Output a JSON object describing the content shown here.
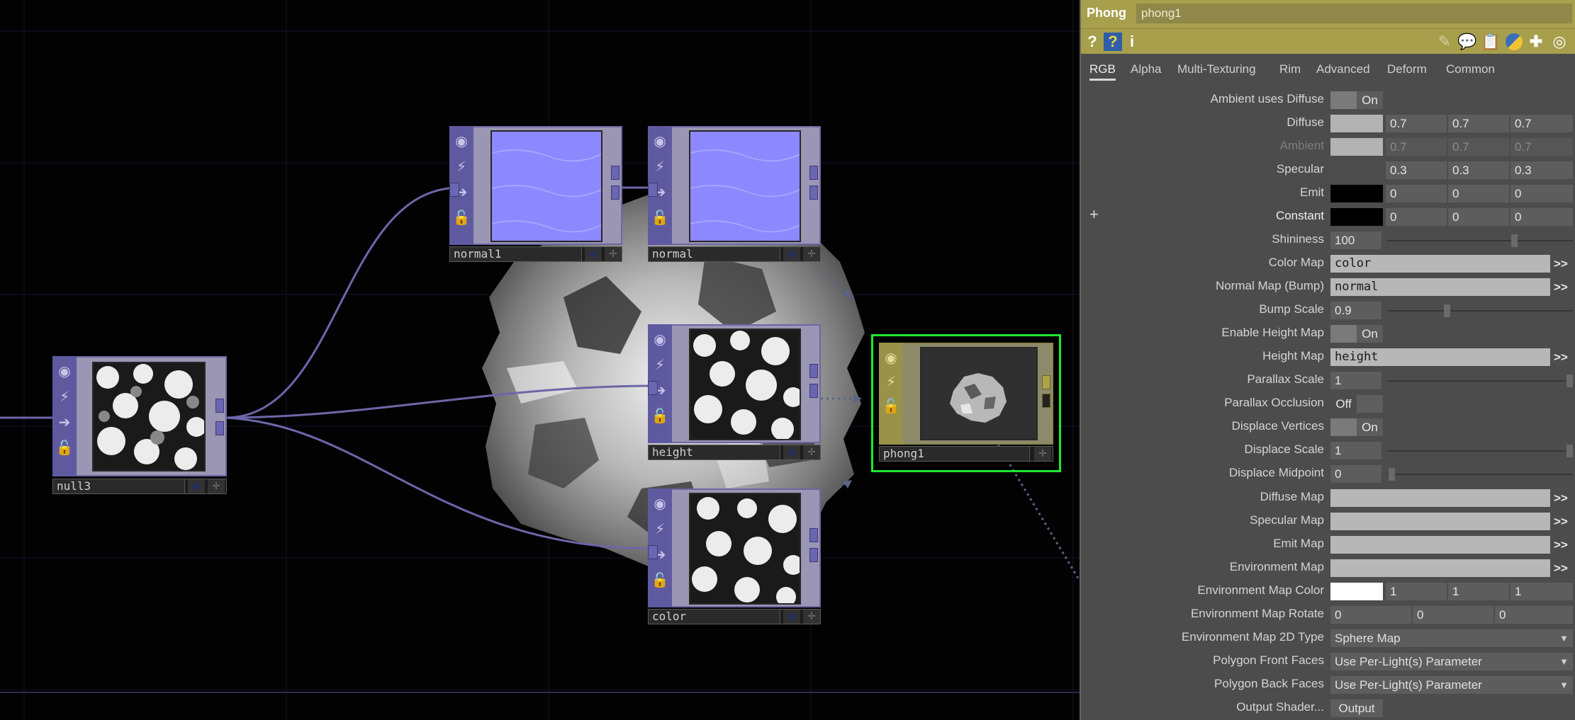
{
  "network": {
    "nodes": {
      "null3": {
        "name": "null3"
      },
      "normal1": {
        "name": "normal1"
      },
      "normal": {
        "name": "normal"
      },
      "height": {
        "name": "height"
      },
      "color": {
        "name": "color"
      },
      "phong1": {
        "name": "phong1"
      }
    },
    "icons": [
      "viewer-icon",
      "bypass-icon",
      "display-icon",
      "lock-icon"
    ],
    "colors": {
      "node_purple": "#5f5aa0",
      "wire": "#6c67a8",
      "selection": "#1ee82c",
      "normal_map": "#8c88ff"
    }
  },
  "panel": {
    "header": {
      "type": "Phong",
      "name": "phong1"
    },
    "toolbar": {
      "left": [
        "?",
        "?",
        "i"
      ],
      "right_icons": [
        "pencil-icon",
        "comment-icon",
        "clipboard-icon",
        "python-icon",
        "plus-icon",
        "target-icon"
      ]
    },
    "tabs": [
      "RGB",
      "Alpha",
      "Multi-Texturing",
      "Rim",
      "Advanced",
      "Deform",
      "Common"
    ],
    "active_tab": "RGB",
    "side_plus": "+",
    "params": {
      "ambient_uses_diffuse": {
        "label": "Ambient uses Diffuse",
        "value": "On"
      },
      "diffuse": {
        "label": "Diffuse",
        "values": [
          "0.7",
          "0.7",
          "0.7"
        ],
        "swatch": "#b3b3b3"
      },
      "ambient": {
        "label": "Ambient",
        "values": [
          "0.7",
          "0.7",
          "0.7"
        ],
        "swatch": "#b3b3b3"
      },
      "specular": {
        "label": "Specular",
        "values": [
          "0.3",
          "0.3",
          "0.3"
        ],
        "swatch": "#4d4d4d"
      },
      "emit": {
        "label": "Emit",
        "values": [
          "0",
          "0",
          "0"
        ],
        "swatch": "#000000"
      },
      "constant": {
        "label": "Constant",
        "values": [
          "0",
          "0",
          "0"
        ],
        "swatch": "#000000"
      },
      "shininess": {
        "label": "Shininess",
        "value": "100"
      },
      "color_map": {
        "label": "Color Map",
        "value": "color"
      },
      "normal_map": {
        "label": "Normal Map (Bump)",
        "value": "normal"
      },
      "bump_scale": {
        "label": "Bump Scale",
        "value": "0.9"
      },
      "enable_height_map": {
        "label": "Enable Height Map",
        "value": "On"
      },
      "height_map": {
        "label": "Height Map",
        "value": "height"
      },
      "parallax_scale": {
        "label": "Parallax Scale",
        "value": "1"
      },
      "parallax_occlusion": {
        "label": "Parallax Occlusion",
        "value": "Off"
      },
      "displace_vertices": {
        "label": "Displace Vertices",
        "value": "On"
      },
      "displace_scale": {
        "label": "Displace Scale",
        "value": "1"
      },
      "displace_midpoint": {
        "label": "Displace Midpoint",
        "value": "0"
      },
      "diffuse_map": {
        "label": "Diffuse Map",
        "value": ""
      },
      "specular_map": {
        "label": "Specular Map",
        "value": ""
      },
      "emit_map": {
        "label": "Emit Map",
        "value": ""
      },
      "environment_map": {
        "label": "Environment Map",
        "value": ""
      },
      "environment_map_color": {
        "label": "Environment Map Color",
        "values": [
          "1",
          "1",
          "1"
        ],
        "swatch": "#ffffff"
      },
      "environment_map_rotate": {
        "label": "Environment Map Rotate",
        "values": [
          "0",
          "0",
          "0"
        ]
      },
      "environment_map_2d_type": {
        "label": "Environment Map 2D Type",
        "value": "Sphere Map"
      },
      "polygon_front_faces": {
        "label": "Polygon Front Faces",
        "value": "Use Per-Light(s) Parameter"
      },
      "polygon_back_faces": {
        "label": "Polygon Back Faces",
        "value": "Use Per-Light(s) Parameter"
      },
      "output_shader": {
        "label": "Output Shader...",
        "value": "Output"
      }
    },
    "op_arrows": ">>"
  }
}
